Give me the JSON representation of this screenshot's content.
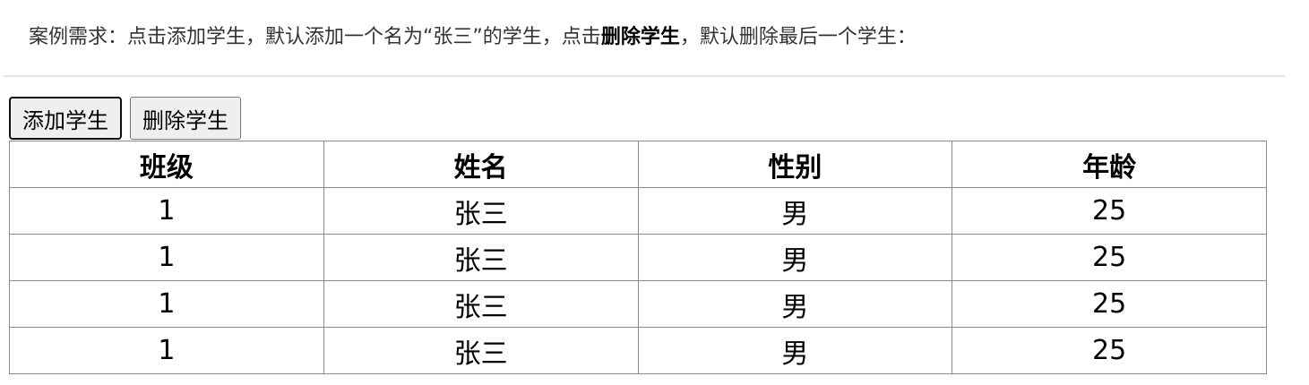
{
  "description": {
    "part1": "案例需求：点击添加学生，默认添加一个名为“张三”的学生，点击",
    "bold": "删除学生",
    "part2": "，默认删除最后一个学生："
  },
  "buttons": {
    "add_label": "添加学生",
    "delete_label": "删除学生"
  },
  "table": {
    "headers": [
      "班级",
      "姓名",
      "性别",
      "年龄"
    ],
    "rows": [
      [
        "1",
        "张三",
        "男",
        "25"
      ],
      [
        "1",
        "张三",
        "男",
        "25"
      ],
      [
        "1",
        "张三",
        "男",
        "25"
      ],
      [
        "1",
        "张三",
        "男",
        "25"
      ]
    ]
  },
  "colors": {
    "description_text": "#333333",
    "divider": "#e3e3e3",
    "button_bg": "#efefef",
    "table_border": "#8a8a8a"
  }
}
